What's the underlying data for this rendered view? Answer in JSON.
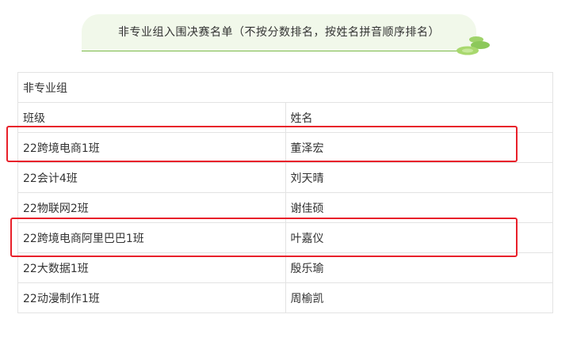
{
  "banner": {
    "title": "非专业组入围决赛名单（不按分数排名，按姓名拼音顺序排名）",
    "icon": "leaf-decoration-icon",
    "accent_color": "#7cba4a",
    "background_color": "#f1f8ea"
  },
  "table": {
    "section_title": "非专业组",
    "headers": {
      "class": "班级",
      "name": "姓名"
    },
    "rows": [
      {
        "class": "22跨境电商1班",
        "name": "董泽宏",
        "highlighted": true
      },
      {
        "class": "22会计4班",
        "name": "刘天晴",
        "highlighted": false
      },
      {
        "class": "22物联网2班",
        "name": "谢佳硕",
        "highlighted": false
      },
      {
        "class": "22跨境电商阿里巴巴1班",
        "name": "叶嘉仪",
        "highlighted": true
      },
      {
        "class": "22大数据1班",
        "name": "殷乐瑜",
        "highlighted": false
      },
      {
        "class": "22动漫制作1班",
        "name": "周榆凯",
        "highlighted": false
      }
    ]
  },
  "highlight_color": "#e8202a"
}
